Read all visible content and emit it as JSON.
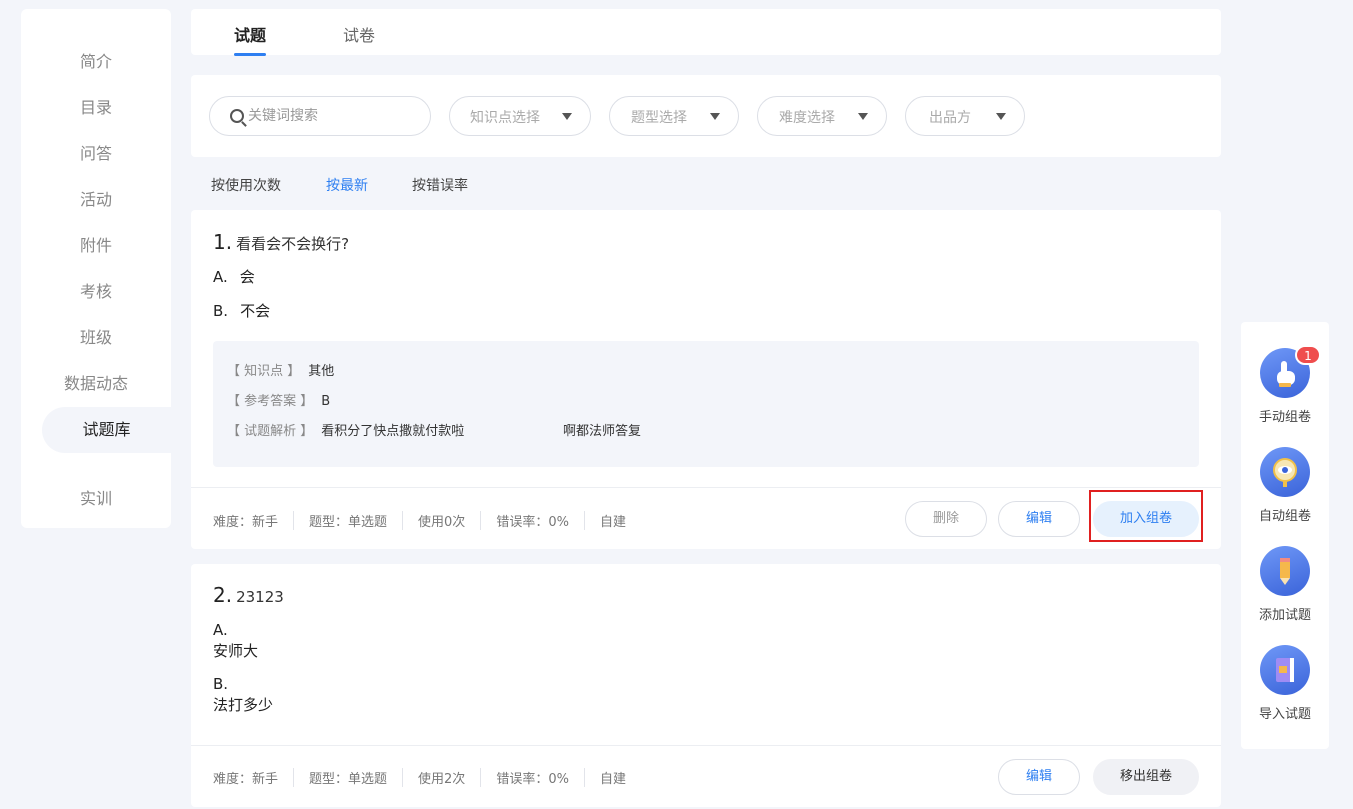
{
  "sidebar": {
    "items": [
      {
        "label": "简介"
      },
      {
        "label": "目录"
      },
      {
        "label": "问答"
      },
      {
        "label": "活动"
      },
      {
        "label": "附件"
      },
      {
        "label": "考核"
      },
      {
        "label": "班级"
      },
      {
        "label": "数据动态"
      },
      {
        "label": "试题库",
        "active": true
      },
      {
        "label": "实训"
      }
    ]
  },
  "tabs": [
    {
      "label": "试题",
      "active": true
    },
    {
      "label": "试卷"
    }
  ],
  "filters": {
    "search_placeholder": "关键词搜索",
    "knowledge_label": "知识点选择",
    "type_label": "题型选择",
    "difficulty_label": "难度选择",
    "publisher_label": "出品方"
  },
  "sort": {
    "by_usage": "按使用次数",
    "by_newest": "按最新",
    "by_error_rate": "按错误率",
    "active": "by_newest"
  },
  "questions": [
    {
      "number": "1.",
      "title": "看看会不会换行?",
      "options": [
        {
          "letter": "A.",
          "text": "会"
        },
        {
          "letter": "B.",
          "text": "不会"
        }
      ],
      "analysis": {
        "knowledge_label": "【 知识点 】",
        "knowledge_value": "其他",
        "answer_label": "【 参考答案 】",
        "answer_value": "B",
        "explain_label": "【 试题解析 】",
        "explain_value": "看积分了快点撒就付款啦",
        "explain_extra": "啊都法师答复"
      },
      "meta": {
        "difficulty": "难度：新手",
        "type": "题型：单选题",
        "usage": "使用0次",
        "error_rate": "错误率：0%",
        "source": "自建"
      },
      "actions": {
        "delete": "删除",
        "edit": "编辑",
        "add": "加入组卷"
      }
    },
    {
      "number": "2.",
      "title": "23123",
      "options": [
        {
          "letter": "A.",
          "text": "安师大"
        },
        {
          "letter": "B.",
          "text": "法打多少"
        }
      ],
      "meta": {
        "difficulty": "难度：新手",
        "type": "题型：单选题",
        "usage": "使用2次",
        "error_rate": "错误率：0%",
        "source": "自建"
      },
      "actions": {
        "edit": "编辑",
        "remove": "移出组卷"
      }
    }
  ],
  "tools": [
    {
      "label": "手动组卷",
      "icon": "hand-pointer-icon",
      "badge": "1"
    },
    {
      "label": "自动组卷",
      "icon": "eye-magnifier-icon"
    },
    {
      "label": "添加试题",
      "icon": "pencil-icon"
    },
    {
      "label": "导入试题",
      "icon": "notebook-import-icon"
    }
  ],
  "colors": {
    "accent": "#2e7ff1",
    "highlight": "#e02020",
    "badge": "#ef4d4d"
  }
}
